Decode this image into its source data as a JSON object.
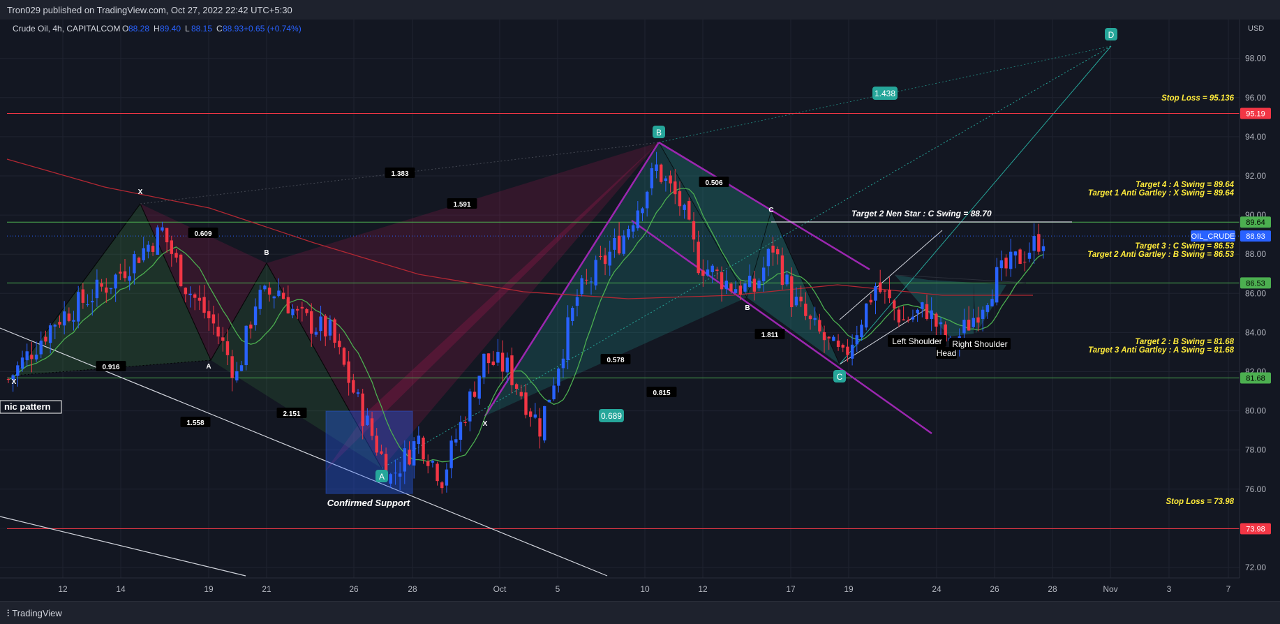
{
  "header": {
    "published": "Tron029 published on TradingView.com, Oct 27, 2022 22:42 UTC+5:30"
  },
  "legend": {
    "symbol": "Crude Oil, 4h, CAPITALCOM",
    "o_label": "O",
    "o": "88.28",
    "h_label": "H",
    "h": "89.40",
    "l_label": "L",
    "l": "88.15",
    "c_label": "C",
    "c": "88.93",
    "change": "+0.65 (+0.74%)"
  },
  "footer": {
    "brand": "TradingView"
  },
  "colors": {
    "bg": "#131722",
    "up": "#2962ff",
    "down": "#f23645",
    "green_line": "#4caf50",
    "red_line": "#f23645",
    "purple": "#9c27b0",
    "teal": "#26a69a",
    "yellow_text": "#ffeb3b"
  },
  "chart_data": {
    "type": "candlestick",
    "currency_label": "USD",
    "y_ticks": [
      "72.00",
      "74.00",
      "76.00",
      "78.00",
      "80.00",
      "82.00",
      "84.00",
      "86.00",
      "88.00",
      "90.00",
      "92.00",
      "94.00",
      "96.00",
      "98.00"
    ],
    "ylim": [
      70.4,
      98.6
    ],
    "x_ticks": [
      "12",
      "14",
      "19",
      "21",
      "26",
      "28",
      "Oct",
      "5",
      "10",
      "12",
      "17",
      "19",
      "24",
      "26",
      "28",
      "Nov",
      "3",
      "7"
    ],
    "close_path": [
      [
        0,
        81.6
      ],
      [
        10,
        84.6
      ],
      [
        22,
        86.6
      ],
      [
        33,
        89.2
      ],
      [
        38,
        86.4
      ],
      [
        44,
        84.4
      ],
      [
        49,
        81.8
      ],
      [
        53,
        85.6
      ],
      [
        58,
        86.2
      ],
      [
        62,
        84.8
      ],
      [
        69,
        84.0
      ],
      [
        75,
        80.4
      ],
      [
        82,
        76.6
      ],
      [
        88,
        78.6
      ],
      [
        93,
        76.6
      ],
      [
        102,
        82.6
      ],
      [
        107,
        82.2
      ],
      [
        114,
        79.2
      ],
      [
        122,
        85.8
      ],
      [
        132,
        89.0
      ],
      [
        139,
        92.4
      ],
      [
        144,
        90.6
      ],
      [
        148,
        87.6
      ],
      [
        155,
        86.4
      ],
      [
        160,
        86.2
      ],
      [
        164,
        88.4
      ],
      [
        168,
        85.8
      ],
      [
        172,
        84.4
      ],
      [
        179,
        82.6
      ],
      [
        186,
        86.4
      ],
      [
        192,
        84.6
      ],
      [
        197,
        85.2
      ],
      [
        202,
        83.2
      ],
      [
        207,
        84.8
      ],
      [
        212,
        86.8
      ],
      [
        220,
        88.5
      ],
      [
        222,
        88.9
      ]
    ],
    "horizontal_levels": [
      {
        "price": 95.19,
        "color": "#f23645",
        "badge": "95.19"
      },
      {
        "price": 89.64,
        "color": "#4caf50",
        "badge": "89.64"
      },
      {
        "price": 88.93,
        "color": "#2962ff",
        "badge": "88.93",
        "dotted": true,
        "name": "OIL_CRUDE"
      },
      {
        "price": 86.53,
        "color": "#4caf50",
        "badge": "86.53"
      },
      {
        "price": 81.68,
        "color": "#4caf50",
        "badge": "81.68"
      },
      {
        "price": 73.98,
        "color": "#f23645",
        "badge": "73.98"
      }
    ],
    "annotations": {
      "stop_loss_high": "Stop Loss = 95.136",
      "target4": "Target 4 : A Swing = 89.64",
      "target1": "Target 1 Anti Gartley : X Swing = 89.64",
      "target2_nenstar": "Target 2 Nen Star : C Swing = 88.70",
      "target3": "Target 3 : C Swing = 86.53",
      "target2_anti": "Target 2  Anti Gartley : B Swing = 86.53",
      "target2_b": "Target 2 : B Swing = 81.68",
      "target3_anti": "Target 3 Anti Gartley : A Swing = 81.68",
      "stop_loss_low": "Stop Loss = 73.98",
      "confirmed_support": "Confirmed Support",
      "left_shoulder": "Left Shoulder",
      "head": "Head",
      "right_shoulder": "Right Shoulder",
      "pattern_box": "nic pattern"
    },
    "ratios": {
      "r1383": "1.383",
      "r1591": "1.591",
      "r0609": "0.609",
      "r0916": "0.916",
      "r1558": "1.558",
      "r2151": "2.151",
      "r0506": "0.506",
      "r0578": "0.578",
      "r0815": "0.815",
      "r1811": "1.811",
      "r0689": "0.689",
      "r1438": "1.438"
    },
    "pivots": {
      "X1": "X",
      "A1": "A",
      "B1": "B",
      "X2": "X",
      "B2": "B",
      "C2": "C",
      "B3": "B",
      "A_main": "A",
      "B_main": "B",
      "C_main": "C",
      "D_main": "D"
    }
  }
}
